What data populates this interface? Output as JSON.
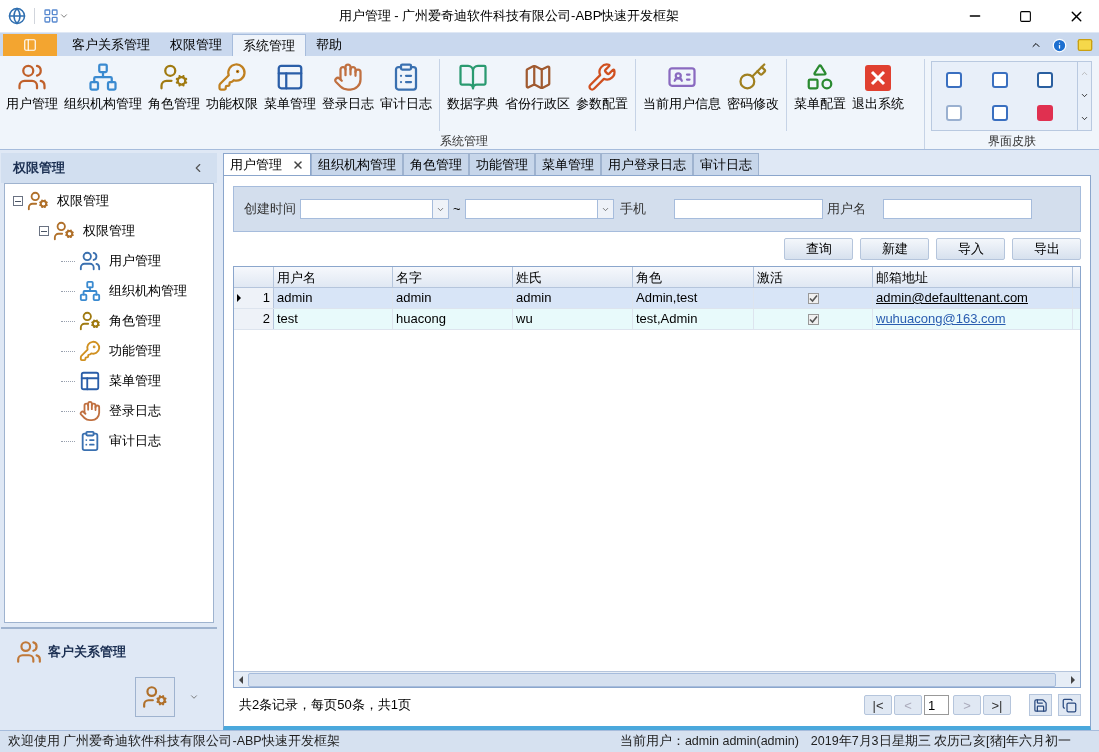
{
  "window": {
    "title": "用户管理 - 广州爱奇迪软件科技有限公司-ABP快速开发框架"
  },
  "ribbon_tabs": [
    {
      "label": "客户关系管理",
      "selected": false
    },
    {
      "label": "权限管理",
      "selected": false
    },
    {
      "label": "系统管理",
      "selected": true
    },
    {
      "label": "帮助",
      "selected": false
    }
  ],
  "ribbon_group": {
    "label": "系统管理",
    "clusters": [
      [
        "用户管理",
        "组织机构管理",
        "角色管理",
        "功能权限",
        "菜单管理",
        "登录日志",
        "审计日志"
      ],
      [
        "数据字典",
        "省份行政区",
        "参数配置"
      ],
      [
        "当前用户信息",
        "密码修改"
      ],
      [
        "菜单配置",
        "退出系统"
      ]
    ]
  },
  "skin_group": {
    "label": "界面皮肤"
  },
  "sidebar": {
    "title": "权限管理",
    "tree": [
      {
        "label": "权限管理",
        "expanded": true,
        "children": [
          {
            "label": "权限管理",
            "expanded": true,
            "children": [
              {
                "label": "用户管理"
              },
              {
                "label": "组织机构管理"
              },
              {
                "label": "角色管理"
              },
              {
                "label": "功能管理"
              },
              {
                "label": "菜单管理"
              },
              {
                "label": "登录日志"
              },
              {
                "label": "审计日志"
              }
            ]
          }
        ]
      }
    ],
    "bottom_section": "客户关系管理"
  },
  "doc_tabs": [
    {
      "label": "用户管理",
      "selected": true
    },
    {
      "label": "组织机构管理",
      "selected": false
    },
    {
      "label": "角色管理",
      "selected": false
    },
    {
      "label": "功能管理",
      "selected": false
    },
    {
      "label": "菜单管理",
      "selected": false
    },
    {
      "label": "用户登录日志",
      "selected": false
    },
    {
      "label": "审计日志",
      "selected": false
    }
  ],
  "filters": {
    "created_label": "创建时间",
    "range_sep": "~",
    "phone_label": "手机",
    "username_label": "用户名"
  },
  "buttons": [
    "查询",
    "新建",
    "导入",
    "导出"
  ],
  "table": {
    "columns": [
      "用户名",
      "名字",
      "姓氏",
      "角色",
      "激活",
      "邮箱地址"
    ],
    "rows": [
      {
        "number": "1",
        "selected": true,
        "current": true,
        "cells": [
          "admin",
          "admin",
          "admin",
          "Admin,test"
        ],
        "active": true,
        "email": "admin@defaulttenant.com"
      },
      {
        "number": "2",
        "selected": false,
        "current": false,
        "cells": [
          "test",
          "huacong",
          "wu",
          "test,Admin"
        ],
        "active": true,
        "email": "wuhuacong@163.com"
      }
    ]
  },
  "pager": {
    "summary": "共2条记录，每页50条，共1页",
    "first": {
      "label": "|<",
      "disabled": false
    },
    "prev": {
      "label": "<",
      "disabled": true
    },
    "page": "1",
    "next": {
      "label": ">",
      "disabled": true
    },
    "last": {
      "label": ">|",
      "disabled": false
    }
  },
  "status_bar": {
    "welcome": "欢迎使用 广州爱奇迪软件科技有限公司-ABP快速开发框架",
    "user": "当前用户：admin admin(admin)",
    "date": "2019年7月3日星期三 农历己亥[猪]年六月初一"
  }
}
